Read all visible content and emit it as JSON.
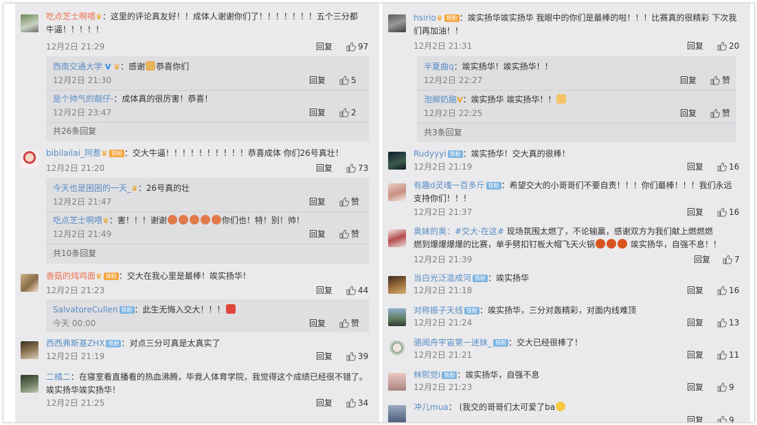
{
  "left": {
    "c1": {
      "user": "吃点芝士啊喂",
      "text": "：这里的评论真友好！！成体人谢谢你们了！！！！！！！五个三分都",
      "text2": "牛逼！！！！！",
      "time": "12月2日 21:29",
      "reply": "回复",
      "likes": "97"
    },
    "c1r1": {
      "user": "西南交通大学",
      "text": "：感谢",
      "text_b": "恭喜你们",
      "time": "12月2日 21:30",
      "reply": "回复",
      "likes": "5"
    },
    "c1r2": {
      "user": "是个帅气的靓仔-",
      "text": "：成体真的很厉害！恭喜！",
      "time": "12月2日 23:47",
      "reply": "回复",
      "likes": "2"
    },
    "c1more": "共26条回复",
    "c2": {
      "user": "bibilailai_阿惹",
      "text": "：交大牛逼！！！！！！！！！！恭喜成体 你们26号真壮！",
      "time": "12月2日 21:20",
      "reply": "回复",
      "likes": "73"
    },
    "c2r1": {
      "user": "今天也是困困的一天_",
      "text": "：26号真的壮",
      "time": "12月2日 21:47",
      "reply": "回复",
      "likes": "赞"
    },
    "c2r2": {
      "user": "吃点芝士啊喂",
      "text": "：害！！！谢谢",
      "text_b": "你们也！特！别！帅！",
      "time": "12月2日 21:49",
      "reply": "回复",
      "likes": "赞"
    },
    "c2more": "共10条回复",
    "c3": {
      "user": "香菇的炖鸡面",
      "text": "：交大在我心里是最棒！竢实扬华！",
      "time": "12月2日 21:23",
      "reply": "回复",
      "likes": "44"
    },
    "c3r1": {
      "user": "SalvatoreCullen",
      "text": "：此生无悔入交大！！！",
      "time": "今天 00:00",
      "reply": "回复",
      "likes": "赞"
    },
    "c4": {
      "user": "西西弗斯基ZHX",
      "text": "：对点三分可真是太真实了",
      "time": "12月2日 21:19",
      "reply": "回复",
      "likes": "39"
    },
    "c5": {
      "user": "二橘二",
      "text": "：在寝室看直播看的热血沸腾，毕竟人体育学院，我觉得这个成绩已经很不错了。",
      "text2": "竢实扬华竢实扬华！",
      "time": "12月2日 21:25",
      "reply": "回复",
      "likes": "34"
    }
  },
  "right": {
    "r1": {
      "user": "hsirio",
      "text": "：竢实扬华竢实扬华 我眼中的你们是最棒的啦！！！比赛真的很精彩 下次我",
      "text2": "们再加油！！",
      "time": "12月2日 21:31",
      "reply": "回复",
      "likes": "20"
    },
    "r1r1": {
      "user": "半夏曲q",
      "text": "：竢实扬华！竢实扬华！！",
      "time": "12月2日 22:27",
      "reply": "回复",
      "likes": "赞"
    },
    "r1r2": {
      "user": "泡脚奶酪",
      "text": "：竢实扬华 竢实扬华！！",
      "time": "12月2日 22:25",
      "reply": "回复",
      "likes": "赞"
    },
    "r1more": "共3条回复",
    "r2": {
      "user": "Rudyyyi",
      "text": "：竢实扬华！交大真的很棒！",
      "time": "12月2日 21:19",
      "reply": "回复",
      "likes": "16"
    },
    "r3": {
      "user": "有趣d灵魂一百多斤",
      "text": "：希望交大的小哥哥们不要自责！！！你们最棒！！！我们永远",
      "text2": "支持你们！！！",
      "time": "12月2日 21:37",
      "reply": "回复",
      "likes": "16"
    },
    "r4": {
      "user": "奥妹的奥",
      "text": "：#交大·在这#",
      "text_b": " 现场氛围太燃了，不论输赢，感谢双方为我们献上燃燃燃",
      "text2": "燃到爆爆爆爆的比赛，单手劈扣钉板大帽飞天火锅",
      "text2b": "竢实扬华，自强不息！！",
      "time": "12月2日 21:39",
      "reply": "回复",
      "likes": "7"
    },
    "r5": {
      "user": "当白光泛滥成河",
      "text": "：竢实扬华",
      "time": "12月2日 21:18",
      "reply": "回复",
      "likes": "16"
    },
    "r6": {
      "user": "对称振子天线",
      "text": "：竢实扬华，三分对轰精彩，对面内线难顶",
      "time": "12月2日 21:24",
      "reply": "回复",
      "likes": "13"
    },
    "r7": {
      "user": "骆闻舟宇宙第一迷妹_",
      "text": "：交大已经很棒了！",
      "time": "12月2日 21:21",
      "reply": "回复",
      "likes": "11"
    },
    "r8": {
      "user": "林熙觉i",
      "text": "：竢实扬华，自强不息",
      "time": "12月2日 21:23",
      "reply": "回复",
      "likes": "9"
    },
    "r9": {
      "user": "冲儿mua",
      "text": "： (我交的哥哥们太可爱了ba",
      "time": "",
      "reply": "回复",
      "likes": "9"
    }
  },
  "badges": {
    "iron": "铁粉",
    "gold": "铁粉"
  },
  "colors": {
    "username": "#eb7350",
    "link": "#5a8dc4",
    "background": "#eaeaec",
    "reply_box": "#dfdfe2",
    "divider": "#7fa6cf"
  }
}
